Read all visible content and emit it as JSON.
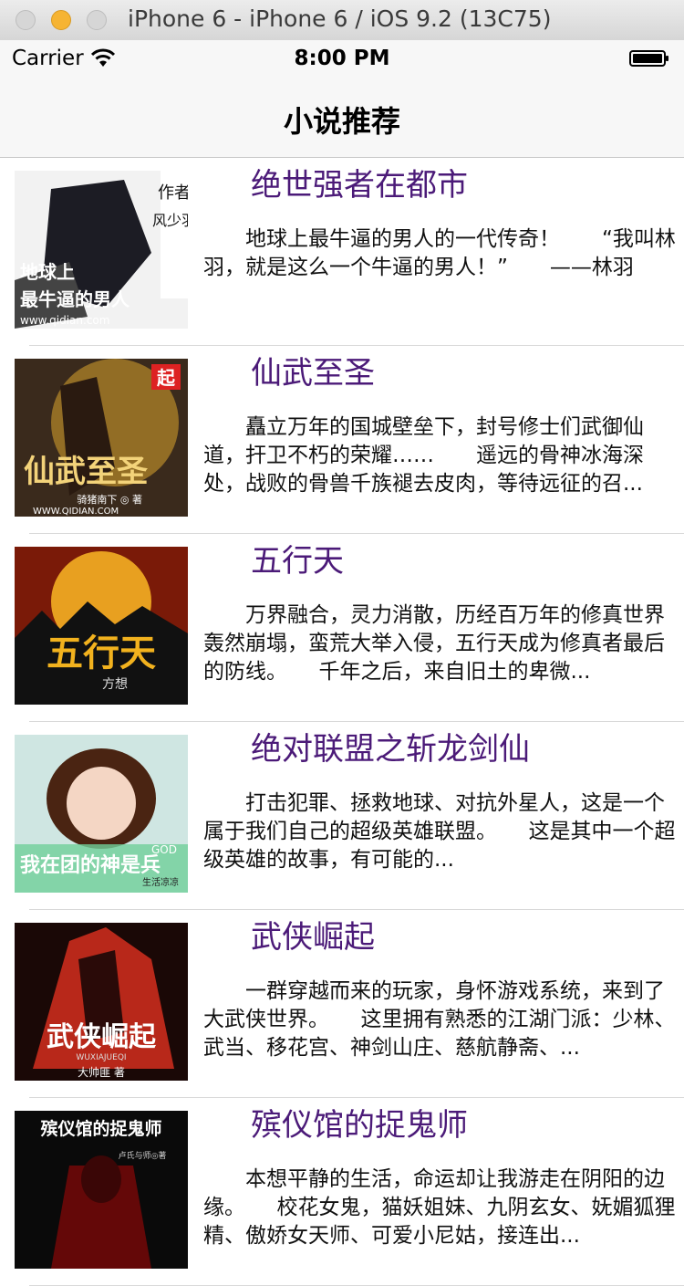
{
  "window": {
    "title": "iPhone 6 - iPhone 6 / iOS 9.2 (13C75)"
  },
  "status_bar": {
    "carrier": "Carrier",
    "time": "8:00 PM"
  },
  "nav": {
    "title": "小说推荐"
  },
  "books": [
    {
      "title": "绝世强者在都市",
      "description": "地球上最牛逼的男人的一代传奇！　　“我叫林羽，就是这么一个牛逼的男人！”　　——林羽",
      "cover_text": [
        "作者",
        "风少羽",
        "地球上",
        "最牛逼的男人",
        "www.qidian.com"
      ],
      "cover_colors": [
        "#f2f2f2",
        "#1c1c24"
      ]
    },
    {
      "title": "仙武至圣",
      "description": "矗立万年的国城壁垒下，封号修士们武御仙道，扞卫不朽的荣耀……　　遥远的骨神冰海深处，战败的骨兽千族褪去皮肉，等待远征的召...",
      "cover_text": [
        "起",
        "仙武至圣",
        "骑猪南下 ◎ 著",
        "WWW.QIDIAN.COM"
      ],
      "cover_colors": [
        "#3a2a1c",
        "#b88a2a"
      ]
    },
    {
      "title": "五行天",
      "description": "万界融合，灵力消散，历经百万年的修真世界轰然崩塌，蛮荒大举入侵，五行天成为修真者最后的防线。　　千年之后，来自旧土的卑微...",
      "cover_text": [
        "五行天",
        "方想"
      ],
      "cover_colors": [
        "#7a1a08",
        "#e8a020"
      ]
    },
    {
      "title": "绝对联盟之斩龙剑仙",
      "description": "打击犯罪、拯救地球、对抗外星人，这是一个属于我们自己的超级英雄联盟。　　这是其中一个超级英雄的故事，有可能的...",
      "cover_text": [
        "我在团的神是兵",
        "GOD",
        "生活凉凉"
      ],
      "cover_colors": [
        "#cfe6e2",
        "#2f5f6a"
      ]
    },
    {
      "title": "武侠崛起",
      "description": "一群穿越而来的玩家，身怀游戏系统，来到了大武侠世界。　　这里拥有熟悉的江湖门派：少林、武当、移花宫、神剑山庄、慈航静斋、...",
      "cover_text": [
        "武侠崛起",
        "WUXIAJUEQI",
        "大帅匪 著"
      ],
      "cover_colors": [
        "#1a0806",
        "#b8281a"
      ]
    },
    {
      "title": "殡仪馆的捉鬼师",
      "description": "本想平静的生活，命运却让我游走在阴阳的边缘。　　校花女鬼，猫妖姐妹、九阴玄女、妩媚狐狸精、傲娇女天师、可爱小尼姑，接连出...",
      "cover_text": [
        "殡仪馆的捉鬼师",
        "卢氏与师◎著"
      ],
      "cover_colors": [
        "#0a0a0a",
        "#7a0808"
      ]
    }
  ]
}
